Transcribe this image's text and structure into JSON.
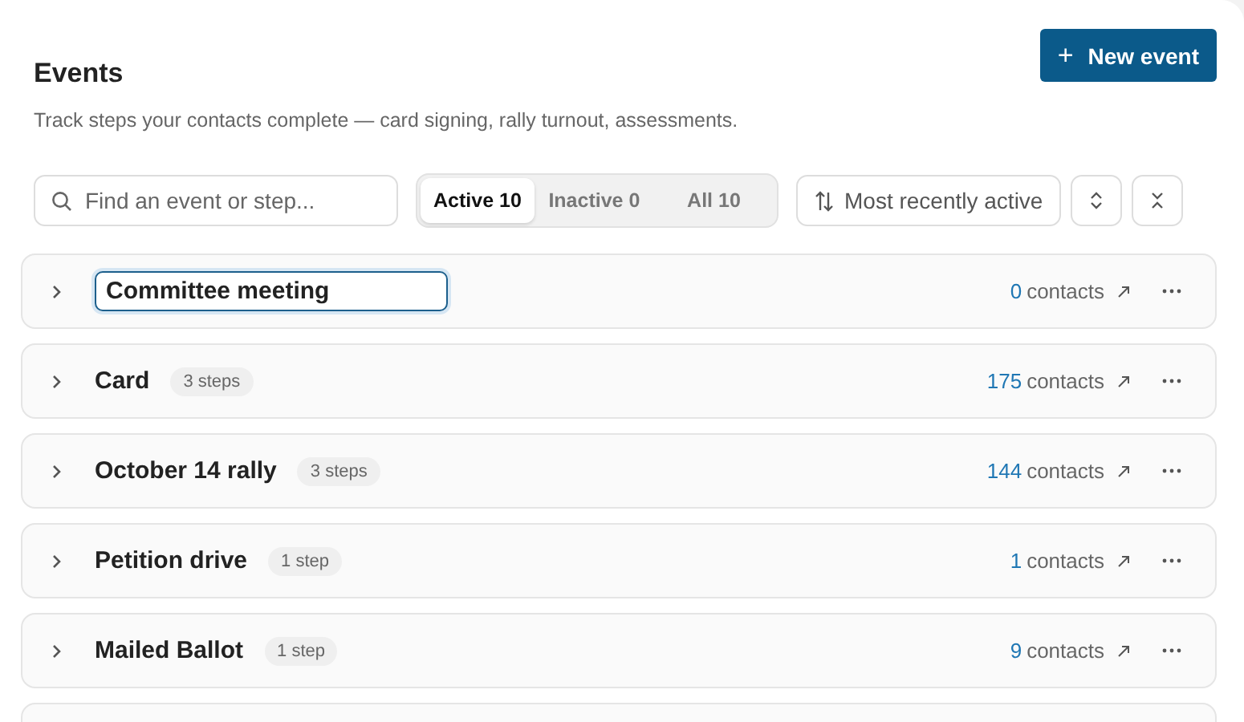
{
  "header": {
    "title": "Events",
    "subtitle": "Track steps your contacts complete — card signing, rally turnout, assessments.",
    "new_button": {
      "icon": "+",
      "label": "New event"
    }
  },
  "toolbar": {
    "search": {
      "placeholder": "Find an event or step..."
    },
    "filters": [
      {
        "label": "Active 10",
        "selected": true
      },
      {
        "label": "Inactive 0",
        "selected": false
      },
      {
        "label": "All 10",
        "selected": false
      }
    ],
    "sort": {
      "label": "Most recently active"
    }
  },
  "events": [
    {
      "name": "Committee meeting",
      "editing": true,
      "count": "0",
      "count_label": "contacts",
      "expanded": false
    },
    {
      "name": "Card",
      "editing": false,
      "steps": "3 steps",
      "count": "175",
      "count_label": "contacts",
      "expanded": false
    },
    {
      "name": "October 14 rally",
      "editing": false,
      "steps": "3 steps",
      "count": "144",
      "count_label": "contacts",
      "expanded": false
    },
    {
      "name": "Petition drive",
      "editing": false,
      "steps": "1 step",
      "count": "1",
      "count_label": "contacts",
      "expanded": false
    },
    {
      "name": "Mailed Ballot",
      "editing": false,
      "steps": "1 step",
      "count": "9",
      "count_label": "contacts",
      "expanded": false
    }
  ],
  "list_continues": true
}
